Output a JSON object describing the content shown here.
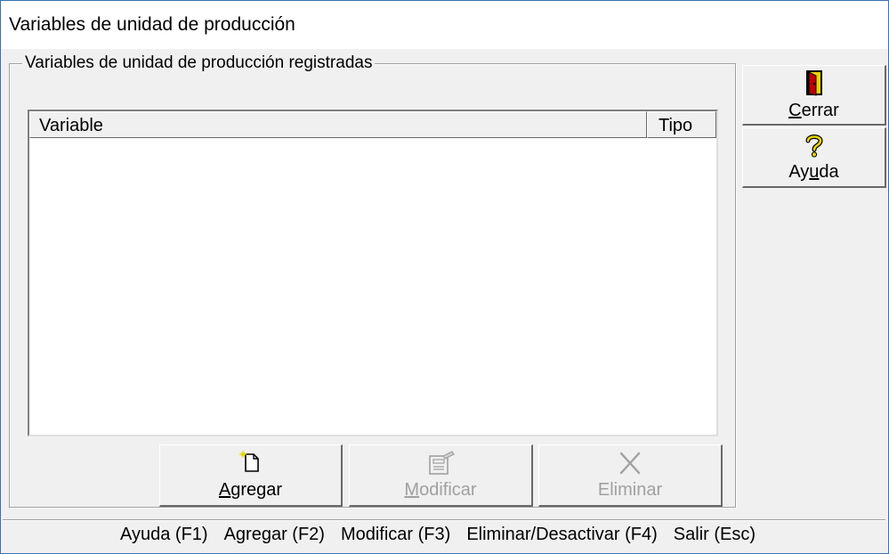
{
  "window": {
    "title": "Variables de unidad de producción"
  },
  "group": {
    "label": "Variables de unidad de producción registradas"
  },
  "list": {
    "columns": [
      "Variable",
      "Tipo"
    ],
    "rows": []
  },
  "buttons": {
    "agregar": {
      "mnemonic": "A",
      "rest": "gregar",
      "icon": "new-document-icon",
      "enabled": true
    },
    "modificar": {
      "mnemonic": "M",
      "rest": "odificar",
      "icon": "edit-document-icon",
      "enabled": false
    },
    "eliminar": {
      "mnemonic": "",
      "rest": "Eliminar",
      "icon": "delete-x-icon",
      "enabled": false
    },
    "cerrar": {
      "mnemonic": "C",
      "rest": "errar",
      "icon": "exit-door-icon"
    },
    "ayuda": {
      "pre": "Ay",
      "mnemonic": "u",
      "post": "da",
      "icon": "help-question-icon"
    }
  },
  "statusbar": {
    "items": [
      "Ayuda (F1)",
      "Agregar (F2)",
      "Modificar (F3)",
      "Eliminar/Desactivar (F4)",
      "Salir (Esc)"
    ]
  }
}
